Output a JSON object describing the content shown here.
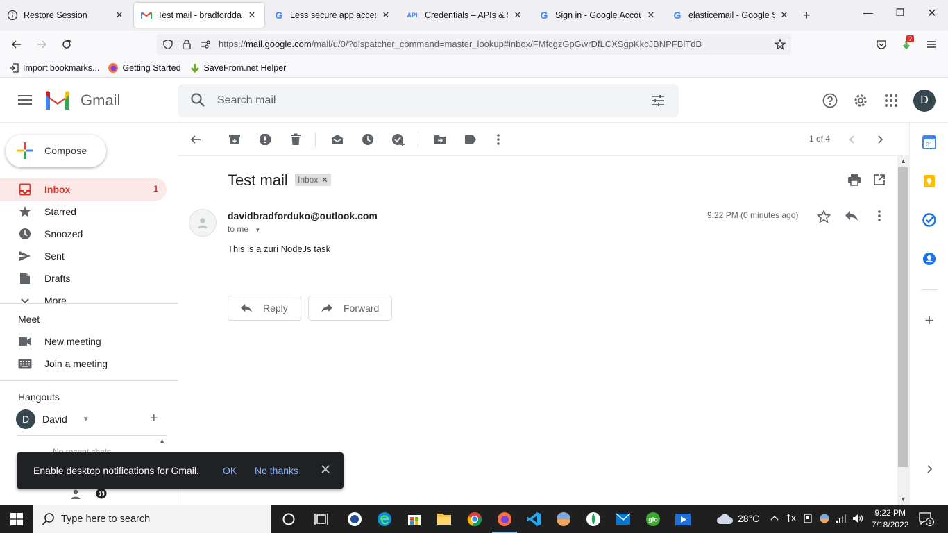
{
  "browser": {
    "tabs": [
      {
        "title": "Restore Session",
        "icon": "info-icon"
      },
      {
        "title": "Test mail - bradforddavid",
        "icon": "gmail-icon"
      },
      {
        "title": "Less secure app access",
        "icon": "google-icon"
      },
      {
        "title": "Credentials – APIs & Servi",
        "icon": "api-icon",
        "icon_text": "API"
      },
      {
        "title": "Sign in - Google Account",
        "icon": "google-icon"
      },
      {
        "title": "elasticemail - Google Sear",
        "icon": "google-icon"
      }
    ],
    "url_prefix": "https://",
    "url_host": "mail.google.com",
    "url_path": "/mail/u/0/?dispatcher_command=master_lookup#inbox/FMfcgzGpGwrDfLCXSgpKkcJBNPFBlTdB",
    "bookmarks": [
      "Import bookmarks...",
      "Getting Started",
      "SaveFrom.net Helper"
    ],
    "extension_badge": "?"
  },
  "gmail": {
    "product": "Gmail",
    "search_placeholder": "Search mail",
    "avatar_letter": "D",
    "compose_label": "Compose",
    "nav": [
      {
        "label": "Inbox",
        "count": "1",
        "icon": "inbox-icon"
      },
      {
        "label": "Starred",
        "icon": "star-icon"
      },
      {
        "label": "Snoozed",
        "icon": "clock-icon"
      },
      {
        "label": "Sent",
        "icon": "send-icon"
      },
      {
        "label": "Drafts",
        "icon": "draft-icon"
      },
      {
        "label": "More",
        "icon": "chevron-down-icon"
      }
    ],
    "meet": {
      "heading": "Meet",
      "new_meeting": "New meeting",
      "join_meeting": "Join a meeting"
    },
    "hangouts": {
      "heading": "Hangouts",
      "user": "David",
      "user_initial": "D",
      "recent": "No recent chats"
    },
    "pager": "1 of 4",
    "message": {
      "subject": "Test mail",
      "label": "Inbox",
      "sender": "davidbradforduko@outlook.com",
      "to": "to me",
      "time": "9:22 PM (0 minutes ago)",
      "body": "This is a zuri NodeJs task",
      "reply_label": "Reply",
      "forward_label": "Forward"
    },
    "snackbar": {
      "text": "Enable desktop notifications for Gmail.",
      "ok": "OK",
      "no": "No thanks"
    }
  },
  "taskbar": {
    "search_placeholder": "Type here to search",
    "weather": "28°C",
    "time": "9:22 PM",
    "date": "7/18/2022",
    "notifications": "1"
  },
  "colors": {
    "gmail_red": "#d93025",
    "active_bg": "#fce8e6",
    "link_blue": "#8ab4f8"
  }
}
